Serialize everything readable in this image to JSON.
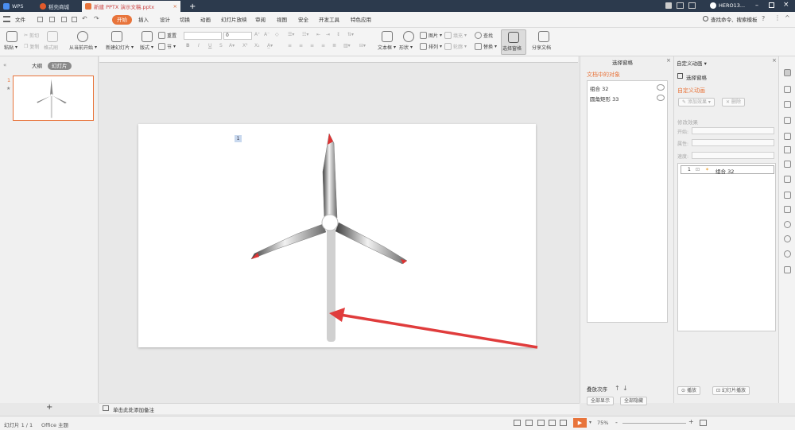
{
  "titlebar": {
    "tabs": [
      {
        "label": "WPS",
        "icon": "wps-logo-icon"
      },
      {
        "label": "稻壳商城",
        "icon": "shop-flame-icon"
      },
      {
        "label": "新建 PPTX 演示文稿.pptx",
        "icon": "ppt-file-icon"
      }
    ],
    "add_tab": "+",
    "user": "HERO13..."
  },
  "menubar": {
    "file": "文件",
    "items": [
      "开始",
      "插入",
      "设计",
      "切换",
      "动画",
      "幻灯片放映",
      "审阅",
      "视图",
      "安全",
      "开发工具",
      "特色应用"
    ],
    "search": "查找命令、搜索模板"
  },
  "ribbon": {
    "paste": "粘贴",
    "cut": "剪切",
    "copy": "复制",
    "format_painter": "格式刷",
    "play_from_current": "从当前开始",
    "new_slide": "新建幻灯片",
    "layout": "版式",
    "reset": "重置",
    "section": "节",
    "font_size": "0",
    "textbox": "文本框",
    "shape": "形状",
    "picture": "图片",
    "fill": "填充",
    "arrange": "排列",
    "outline": "轮廓",
    "find": "查找",
    "replace": "替换",
    "selection_pane": "选择窗格",
    "share": "分享文档"
  },
  "leftpanel": {
    "tabs": [
      "大纲",
      "幻灯片"
    ],
    "slide_number": "1",
    "add": "+"
  },
  "slide": {
    "tag_number": "1"
  },
  "selection_pane": {
    "title": "选择窗格",
    "heading": "文档中的对象",
    "objects": [
      "组合 32",
      "圆角矩形 33"
    ],
    "order_label": "叠放次序",
    "show_all": "全部显示",
    "hide_all": "全部隐藏"
  },
  "animation_pane": {
    "title": "自定义动画",
    "select_pane": "选择窗格",
    "custom_heading": "自定义动画",
    "add_effect": "添加效果",
    "delete": "删除",
    "modify_heading": "修改效果",
    "start": "开始:",
    "property": "属性:",
    "speed": "速度:",
    "anim_item_num": "1",
    "anim_item": "组合 32",
    "play": "播放",
    "slideshow": "幻灯片播放"
  },
  "notes": {
    "placeholder": "单击此处添加备注"
  },
  "statusbar": {
    "slide_info": "幻灯片 1 / 1",
    "theme": "Office 主题",
    "zoom": "75%",
    "minus": "-",
    "plus": "+"
  },
  "colors": {
    "accent": "#e8743b",
    "titlebar": "#2c3a4d",
    "arrow": "#e03c3c"
  }
}
